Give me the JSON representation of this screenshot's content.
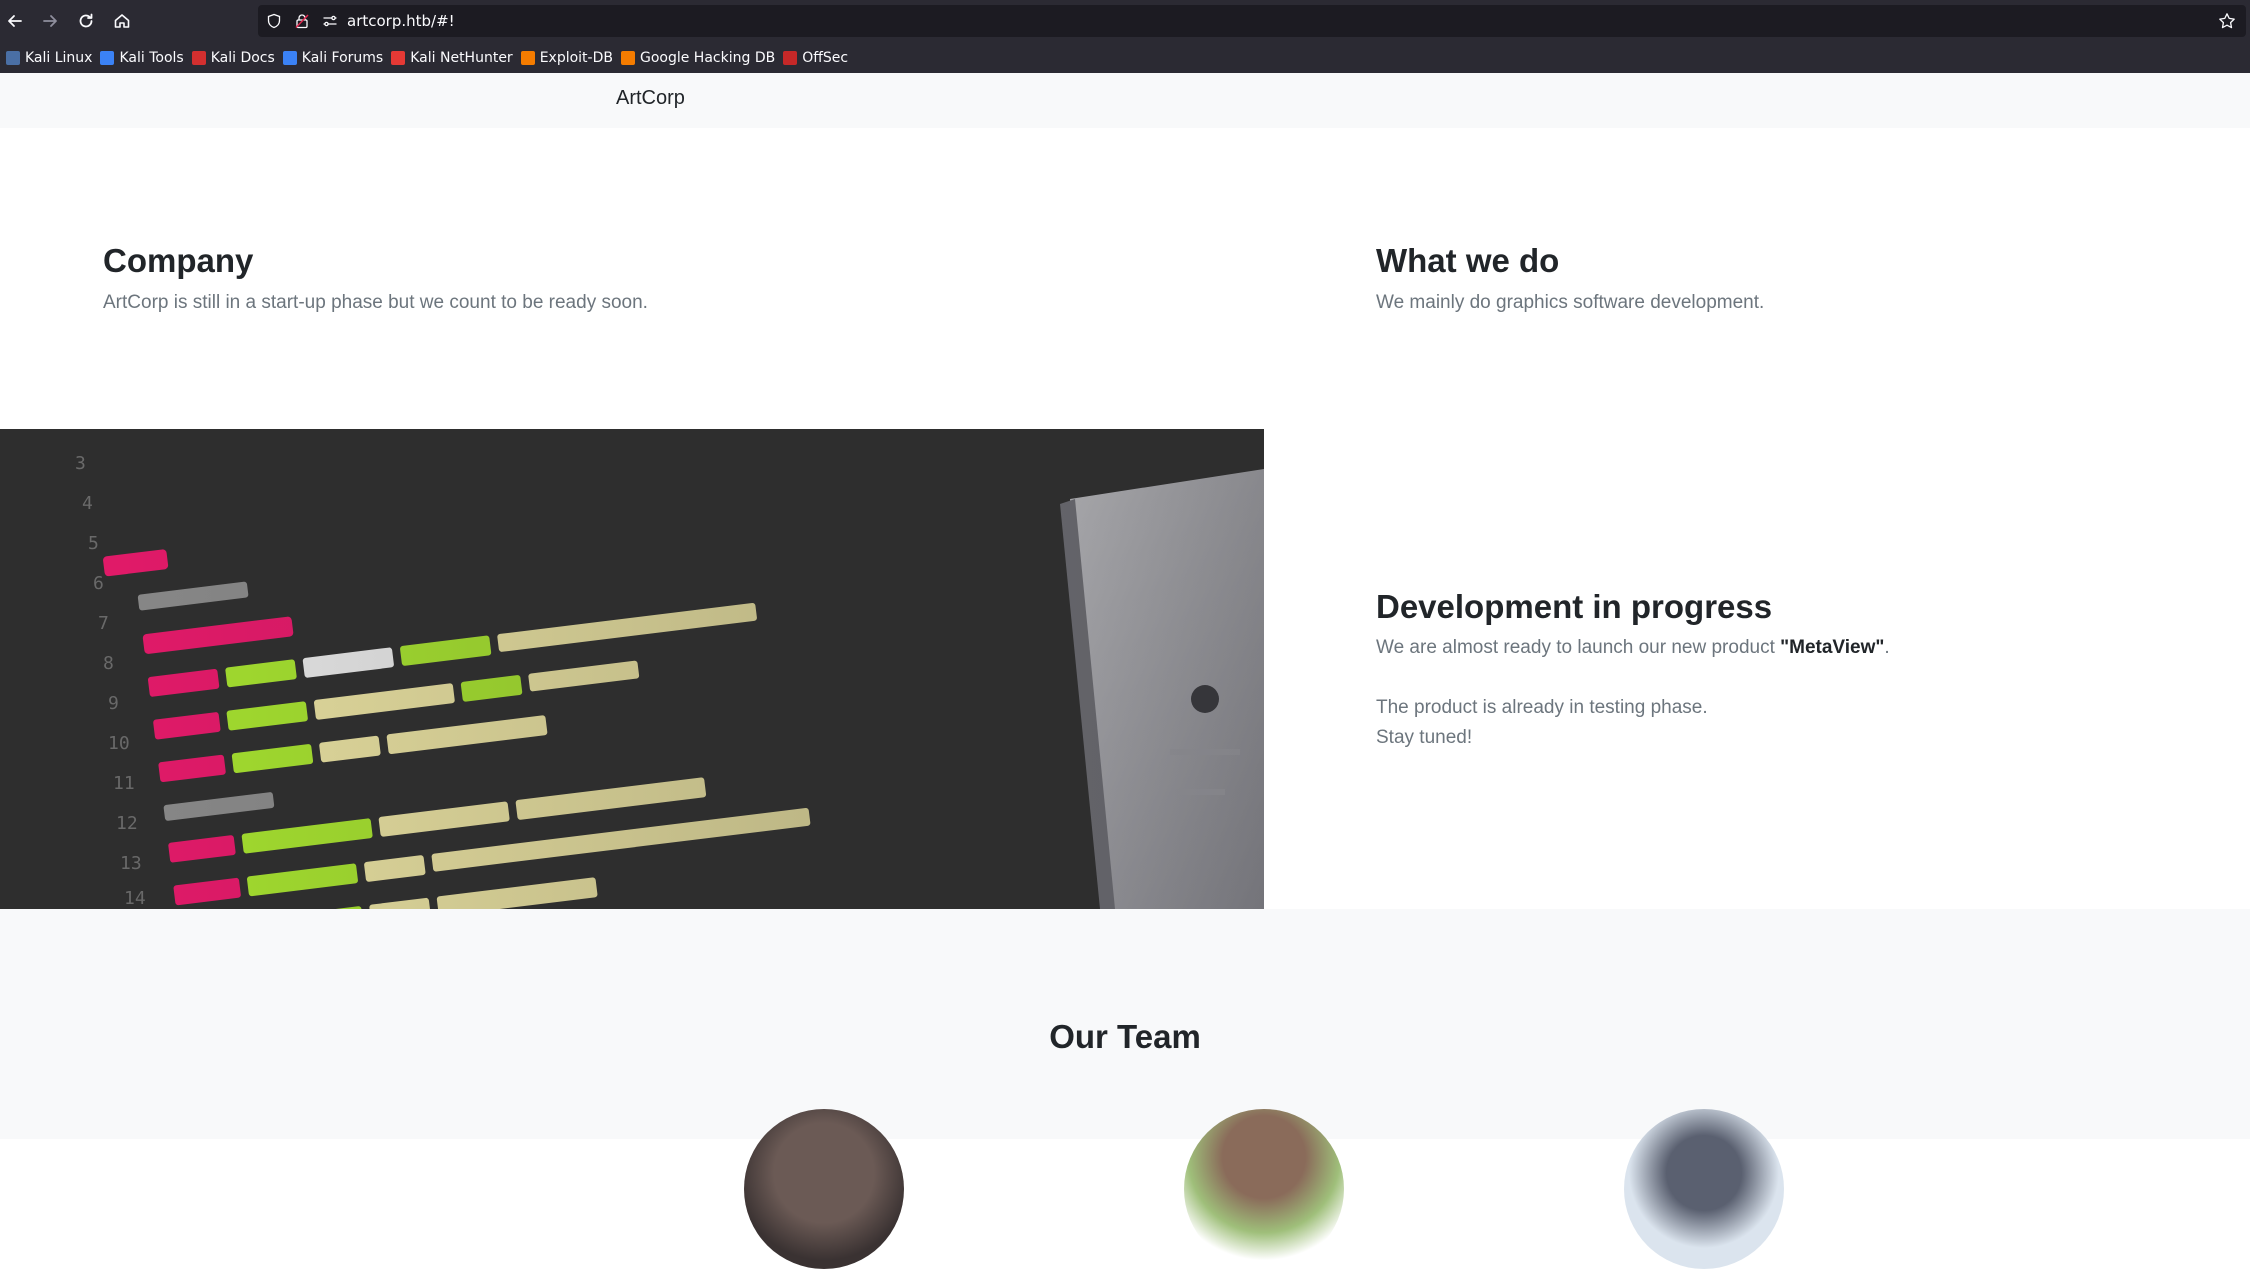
{
  "browser": {
    "url": "artcorp.htb/#!",
    "bookmarks": [
      {
        "label": "Kali Linux",
        "icon": "kali-linux-icon",
        "color": "#4a6fa5"
      },
      {
        "label": "Kali Tools",
        "icon": "kali-tools-icon",
        "color": "#3b82f6"
      },
      {
        "label": "Kali Docs",
        "icon": "kali-docs-icon",
        "color": "#d32f2f"
      },
      {
        "label": "Kali Forums",
        "icon": "kali-forums-icon",
        "color": "#3b82f6"
      },
      {
        "label": "Kali NetHunter",
        "icon": "kali-nethunter-icon",
        "color": "#e53935"
      },
      {
        "label": "Exploit-DB",
        "icon": "exploit-db-icon",
        "color": "#f57c00"
      },
      {
        "label": "Google Hacking DB",
        "icon": "google-hacking-db-icon",
        "color": "#f57c00"
      },
      {
        "label": "OffSec",
        "icon": "offsec-icon",
        "color": "#c62828"
      }
    ]
  },
  "site": {
    "brand": "ArtCorp",
    "company": {
      "title": "Company",
      "text": "ArtCorp is still in a start-up phase but we count to be ready soon."
    },
    "what_we_do": {
      "title": "What we do",
      "text": "We mainly do graphics software development."
    },
    "development": {
      "title": "Development in progress",
      "text_prefix": "We are almost ready to launch our new product ",
      "product": "\"MetaView\"",
      "text_suffix": ".",
      "line2": "The product is already in testing phase.",
      "line3": "Stay tuned!"
    },
    "team": {
      "title": "Our Team"
    }
  },
  "colors": {
    "chrome_bg": "#2b2a33",
    "urlbar_bg": "#1c1b22",
    "navbar_bg": "#f8f9fa",
    "heading": "#212529",
    "muted_text": "#6c757d"
  }
}
